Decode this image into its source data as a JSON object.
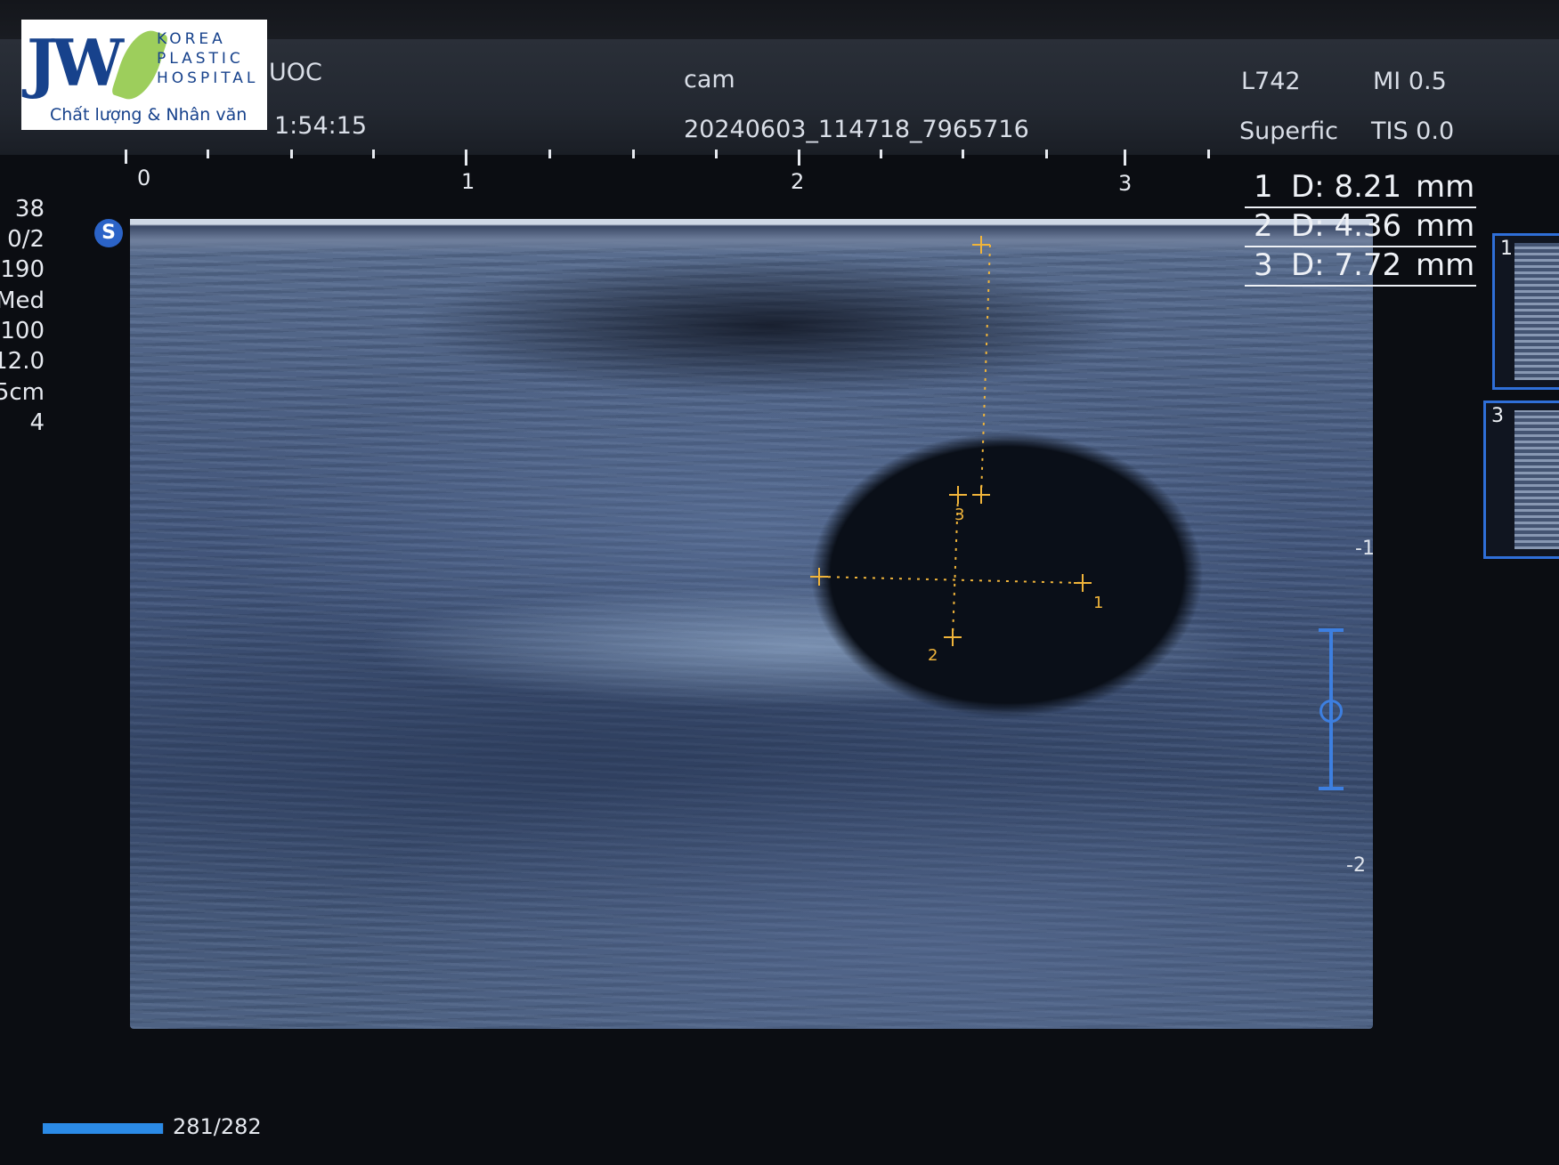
{
  "header": {
    "patient_name_partial": "UOC",
    "datetime_partial": "1:54:15",
    "exam_label": "cam",
    "image_id": "20240603_114718_7965716",
    "probe": "L742",
    "preset": "Superfic",
    "mi": "MI 0.5",
    "tis": "TIS 0.0"
  },
  "logo": {
    "mark": "JW",
    "line1": "KOREA",
    "line2": "PLASTIC",
    "line3": "HOSPITAL",
    "tagline": "Chất lượng & Nhân văn"
  },
  "ruler": {
    "labels": [
      "0",
      "1",
      "2",
      "3"
    ]
  },
  "parameters": [
    "38",
    "0/2",
    "190",
    "Med",
    "100",
    "12.0",
    "5cm",
    "4"
  ],
  "measurements": [
    {
      "index": "1",
      "label": "D: 8.21",
      "unit": "mm",
      "value_mm": 8.21
    },
    {
      "index": "2",
      "label": "D: 4.36",
      "unit": "mm",
      "value_mm": 4.36
    },
    {
      "index": "3",
      "label": "D: 7.72",
      "unit": "mm",
      "value_mm": 7.72
    }
  ],
  "depth_scale": {
    "labels": [
      "-1",
      "-2"
    ]
  },
  "thumbnails": [
    {
      "label": "1"
    },
    {
      "label": "3"
    }
  ],
  "cine": {
    "frame_text": "281/282",
    "progress": 0.996
  },
  "colors": {
    "caliper": "#f0b43a",
    "accent_blue": "#2f6fd8"
  },
  "icons": {
    "probe_badge": "S"
  }
}
